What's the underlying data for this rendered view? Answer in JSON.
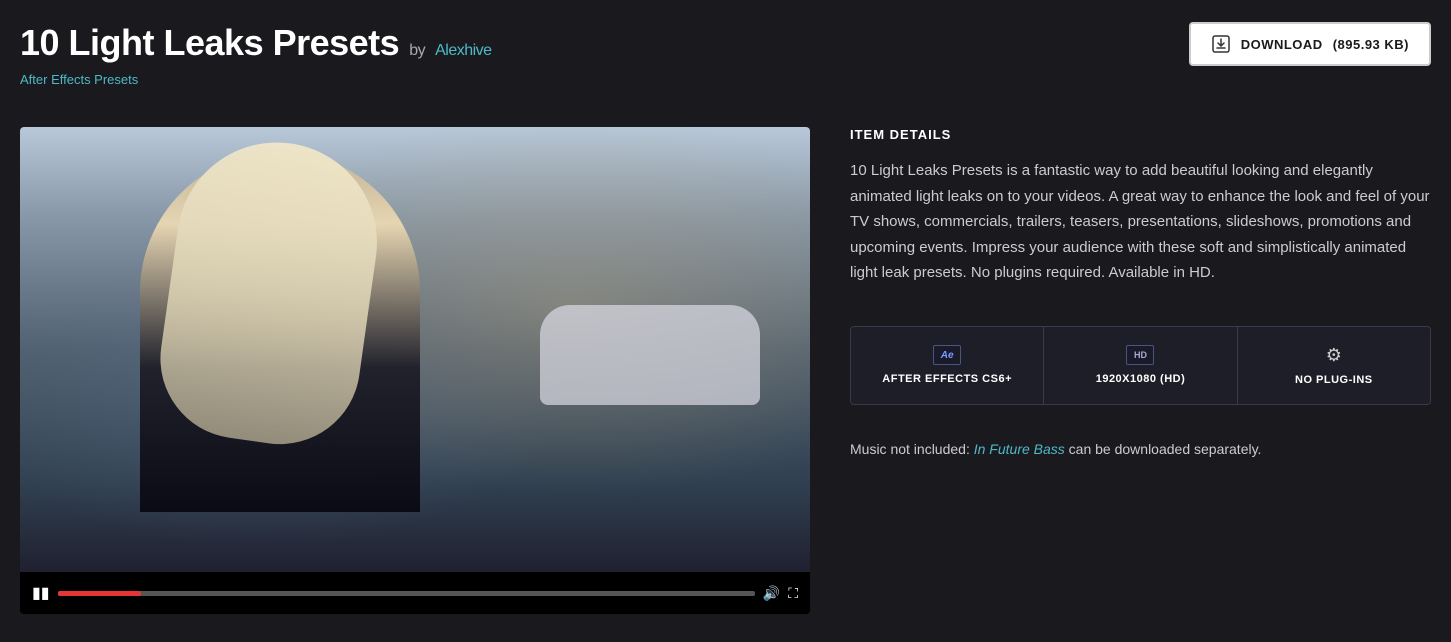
{
  "header": {
    "title": "10 Light Leaks Presets",
    "by_label": "by",
    "author": "Alexhive",
    "download_label": "DOWNLOAD",
    "download_size": "(895.93 KB)",
    "breadcrumb": "After Effects Presets"
  },
  "details": {
    "section_label": "ITEM DETAILS",
    "description": "10 Light Leaks Presets is a fantastic way to add beautiful looking and elegantly animated light leaks on to your videos. A great way to enhance the look and feel of your TV shows, commercials, trailers, teasers, presentations, slideshows, promotions and upcoming events. Impress your audience with these soft and simplistically animated light leak presets. No plugins required. Available in HD.",
    "specs": [
      {
        "icon_type": "ae",
        "label": "AFTER EFFECTS CS6+"
      },
      {
        "icon_type": "hd",
        "label": "1920X1080 (HD)"
      },
      {
        "icon_type": "gear",
        "label": "NO PLUG-INS"
      }
    ],
    "music_note_prefix": "Music not included:",
    "music_link_text": "In Future Bass",
    "music_note_suffix": "can be downloaded separately."
  },
  "player": {
    "progress_percent": 12
  }
}
